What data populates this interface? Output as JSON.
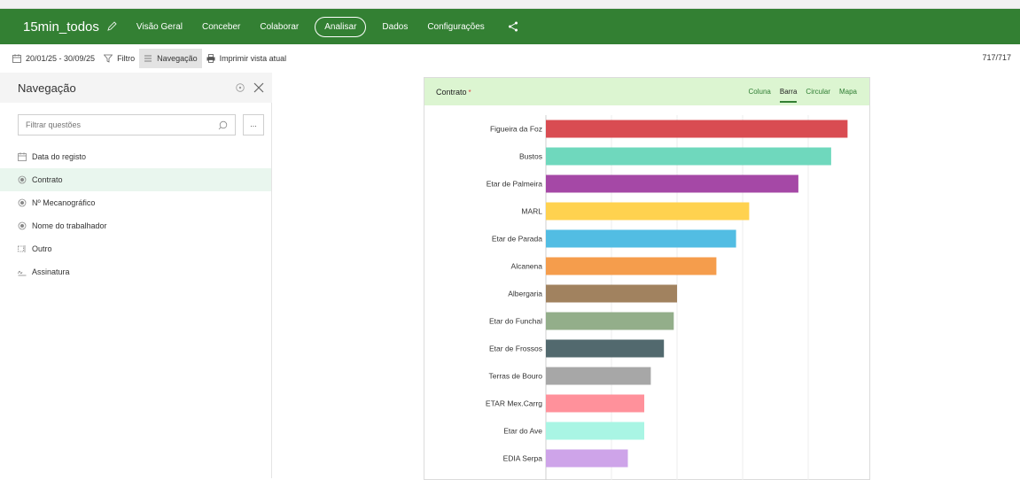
{
  "header": {
    "app_title": "15min_todos",
    "nav": [
      "Visão Geral",
      "Conceber",
      "Colaborar",
      "Analisar",
      "Dados",
      "Configurações"
    ],
    "active_nav": "Analisar"
  },
  "toolbar": {
    "date_range": "20/01/25 - 30/09/25",
    "filter_label": "Filtro",
    "navigation_label": "Navegação",
    "print_label": "Imprimir vista atual",
    "count": "717/717"
  },
  "side": {
    "title": "Navegação",
    "filter_placeholder": "Filtrar questões",
    "more_label": "...",
    "items": [
      {
        "label": "Data do registo",
        "icon": "calendar-icon"
      },
      {
        "label": "Contrato",
        "icon": "radio-icon"
      },
      {
        "label": "Nº Mecanográfico",
        "icon": "radio-icon"
      },
      {
        "label": "Nome do trabalhador",
        "icon": "radio-icon"
      },
      {
        "label": "Outro",
        "icon": "text-field-icon"
      },
      {
        "label": "Assinatura",
        "icon": "signature-icon"
      }
    ],
    "selected_index": 1
  },
  "card": {
    "title": "Contrato",
    "required_mark": "*",
    "tabs": [
      "Coluna",
      "Barra",
      "Circular",
      "Mapa"
    ],
    "active_tab": "Barra"
  },
  "chart_data": {
    "type": "bar",
    "orientation": "horizontal",
    "categories": [
      "Figueira da Foz",
      "Bustos",
      "Etar de Palmeira",
      "MARL",
      "Etar de Parada",
      "Alcanena",
      "Albergaria",
      "Etar do Funchal",
      "Etar de Frossos",
      "Terras de Bouro",
      "ETAR Mex.Carrg",
      "Etar do Ave",
      "EDIA Serpa"
    ],
    "values": [
      46,
      43.5,
      38.5,
      31,
      29,
      26,
      20,
      19.5,
      18,
      16,
      15,
      15,
      12.5
    ],
    "xlim": [
      0,
      50
    ],
    "colors": [
      "#d94c52",
      "#6fd8bd",
      "#a548a6",
      "#ffd24f",
      "#52bde3",
      "#f59d4c",
      "#a1825f",
      "#93ae8a",
      "#52696e",
      "#a7a7a7",
      "#ff919b",
      "#a9f5e4",
      "#cea4e9"
    ],
    "grid": true
  }
}
